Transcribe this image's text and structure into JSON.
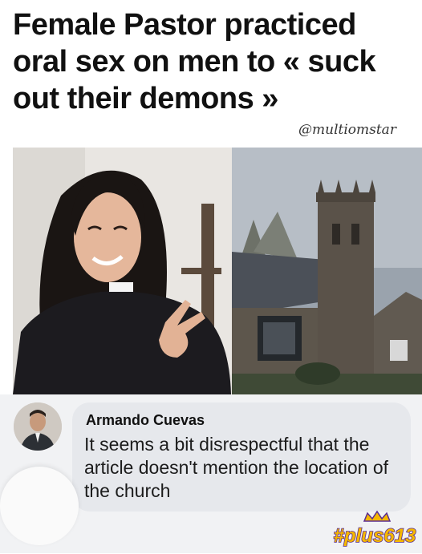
{
  "post": {
    "headline": "Female Pastor practiced oral sex on men to « suck out their demons »",
    "handle": "@multiomstar",
    "images": {
      "left": "pastor-portrait-peace-sign",
      "right": "stone-church-tower"
    }
  },
  "comment": {
    "author": "Armando Cuevas",
    "text": "It seems a bit disrespectful that the article doesn't mention the location of the church",
    "avatar_icon": "user-avatar-photo"
  },
  "watermark": {
    "text": "#plus613",
    "colors": {
      "gold": "#f5b800",
      "purple": "#5a2d91"
    }
  },
  "colors": {
    "comment_background": "#f1f2f4",
    "bubble_background": "#e6e8ec",
    "headline": "#111111"
  }
}
